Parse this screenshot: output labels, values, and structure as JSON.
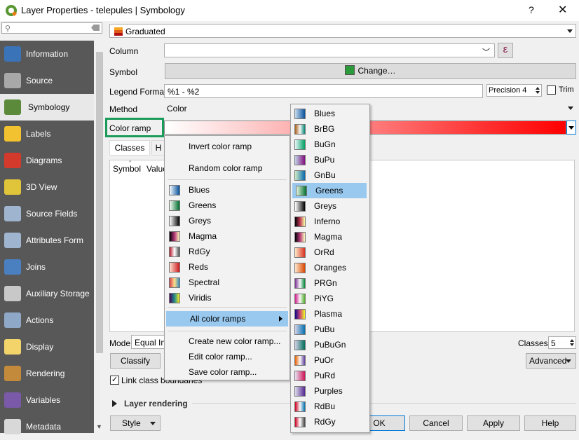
{
  "window": {
    "title": "Layer Properties - telepules | Symbology",
    "help_glyph": "?",
    "close_glyph": "✕"
  },
  "sidebar": {
    "search_placeholder": "",
    "items": [
      {
        "label": "Information",
        "icon": "information-icon",
        "color": "#3b73b9"
      },
      {
        "label": "Source",
        "icon": "source-icon",
        "color": "#a8a8a8"
      },
      {
        "label": "Symbology",
        "icon": "symbology-icon",
        "color": "#5a8a3a"
      },
      {
        "label": "Labels",
        "icon": "labels-icon",
        "color": "#f2c230"
      },
      {
        "label": "Diagrams",
        "icon": "diagrams-icon",
        "color": "#d33a2c"
      },
      {
        "label": "3D View",
        "icon": "3d-view-icon",
        "color": "#e0c43a"
      },
      {
        "label": "Source Fields",
        "icon": "source-fields-icon",
        "color": "#9fb5cf"
      },
      {
        "label": "Attributes Form",
        "icon": "attributes-form-icon",
        "color": "#9fb5cf"
      },
      {
        "label": "Joins",
        "icon": "joins-icon",
        "color": "#4a7fc0"
      },
      {
        "label": "Auxiliary Storage",
        "icon": "auxiliary-storage-icon",
        "color": "#c8c8c8"
      },
      {
        "label": "Actions",
        "icon": "actions-icon",
        "color": "#8fa8c8"
      },
      {
        "label": "Display",
        "icon": "display-icon",
        "color": "#f2d46a"
      },
      {
        "label": "Rendering",
        "icon": "rendering-icon",
        "color": "#c28a3a"
      },
      {
        "label": "Variables",
        "icon": "variables-icon",
        "color": "#7a5aa8"
      },
      {
        "label": "Metadata",
        "icon": "metadata-icon",
        "color": "#d8d8d8"
      }
    ],
    "active_index": 2
  },
  "main": {
    "renderer": "Graduated",
    "column_label": "Column",
    "column_value": "",
    "expression_glyph": "ε",
    "symbol_label": "Symbol",
    "symbol_button": "Change…",
    "symbol_color": "#2a9a3a",
    "legend_label": "Legend Format",
    "legend_value": "%1 - %2",
    "precision": "Precision 4",
    "trim_label": "Trim",
    "method_label": "Method",
    "method_value": "Color",
    "color_ramp_label": "Color ramp",
    "tabs": [
      "Classes",
      "H"
    ],
    "table_headers": [
      "Symbol",
      "Value"
    ],
    "mode_label": "Mode",
    "mode_value": "Equal Int",
    "classes_label": "Classes",
    "classes_value": "5",
    "classify_button": "Classify",
    "advanced_button": "Advanced",
    "link_class_label": "Link class boundaries",
    "layer_rendering": "Layer rendering",
    "style_button": "Style",
    "ok_button": "OK",
    "cancel_button": "Cancel",
    "apply_button": "Apply",
    "help_button": "Help"
  },
  "context_menu": {
    "actions_top": [
      "Invert color ramp",
      "Random color ramp"
    ],
    "ramps": [
      {
        "label": "Blues",
        "grad": [
          "#f7fbff",
          "#08519c"
        ]
      },
      {
        "label": "Greens",
        "grad": [
          "#f7fcf5",
          "#006d2c"
        ]
      },
      {
        "label": "Greys",
        "grad": [
          "#ffffff",
          "#000000"
        ]
      },
      {
        "label": "Magma",
        "grad": [
          "#000004",
          "#b73779",
          "#fcfdbf"
        ]
      },
      {
        "label": "RdGy",
        "grad": [
          "#b2182b",
          "#ffffff",
          "#4d4d4d"
        ]
      },
      {
        "label": "Reds",
        "grad": [
          "#fee0d2",
          "#cb181d"
        ]
      },
      {
        "label": "Spectral",
        "grad": [
          "#d53e4f",
          "#fee08b",
          "#3288bd"
        ]
      },
      {
        "label": "Viridis",
        "grad": [
          "#440154",
          "#21908d",
          "#fde725"
        ]
      }
    ],
    "all_ramps": "All color ramps",
    "actions_bottom": [
      "Create new color ramp...",
      "Edit color ramp...",
      "Save color ramp..."
    ]
  },
  "submenu": {
    "highlighted": "Greens",
    "items": [
      {
        "label": "Blues",
        "grad": [
          "#c6dbef",
          "#08519c"
        ]
      },
      {
        "label": "BrBG",
        "grad": [
          "#a6611a",
          "#f5f5f5",
          "#018571"
        ]
      },
      {
        "label": "BuGn",
        "grad": [
          "#e5f5f9",
          "#00a060"
        ]
      },
      {
        "label": "BuPu",
        "grad": [
          "#bfd3e6",
          "#810f7c"
        ]
      },
      {
        "label": "GnBu",
        "grad": [
          "#ccebc5",
          "#0868ac"
        ]
      },
      {
        "label": "Greens",
        "grad": [
          "#e5f5e0",
          "#006d2c"
        ]
      },
      {
        "label": "Greys",
        "grad": [
          "#ffffff",
          "#000000"
        ]
      },
      {
        "label": "Inferno",
        "grad": [
          "#000004",
          "#bc3754",
          "#fcffa4"
        ]
      },
      {
        "label": "Magma",
        "grad": [
          "#000004",
          "#b73779",
          "#fcfdbf"
        ]
      },
      {
        "label": "OrRd",
        "grad": [
          "#fee8c8",
          "#d7301f"
        ]
      },
      {
        "label": "Oranges",
        "grad": [
          "#fee6ce",
          "#d94801"
        ]
      },
      {
        "label": "PRGn",
        "grad": [
          "#7b3294",
          "#f7f7f7",
          "#008837"
        ]
      },
      {
        "label": "PiYG",
        "grad": [
          "#d01c8b",
          "#f7f7f7",
          "#4dac26"
        ]
      },
      {
        "label": "Plasma",
        "grad": [
          "#0d0887",
          "#cc4778",
          "#f0f921"
        ]
      },
      {
        "label": "PuBu",
        "grad": [
          "#d0d1e6",
          "#0570b0"
        ]
      },
      {
        "label": "PuBuGn",
        "grad": [
          "#d0d1e6",
          "#016c59"
        ]
      },
      {
        "label": "PuOr",
        "grad": [
          "#e66101",
          "#f7f7f7",
          "#5e3c99"
        ]
      },
      {
        "label": "PuRd",
        "grad": [
          "#e7e1ef",
          "#ce1256"
        ]
      },
      {
        "label": "Purples",
        "grad": [
          "#dadaeb",
          "#54278f"
        ]
      },
      {
        "label": "RdBu",
        "grad": [
          "#ca0020",
          "#f7f7f7",
          "#0571b0"
        ]
      },
      {
        "label": "RdGy",
        "grad": [
          "#ca0020",
          "#ffffff",
          "#404040"
        ]
      }
    ]
  }
}
